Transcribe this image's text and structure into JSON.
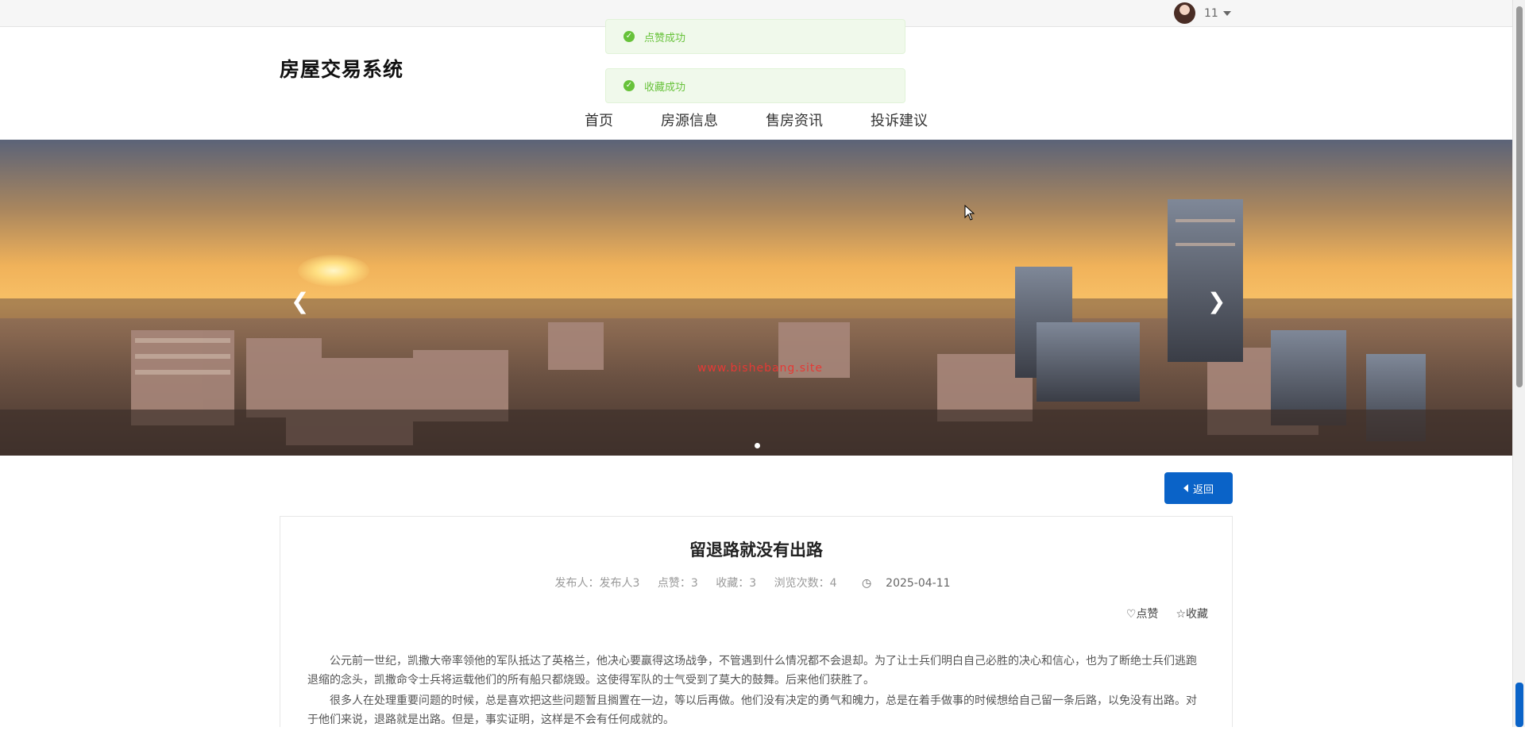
{
  "user": {
    "name": "11"
  },
  "site": {
    "title": "房屋交易系统"
  },
  "nav": [
    "首页",
    "房源信息",
    "售房资讯",
    "投诉建议"
  ],
  "toasts": [
    "点赞成功",
    "收藏成功"
  ],
  "banner": {
    "watermark": "www.bishebang.site",
    "prev_icon": "chevron-left-icon",
    "next_icon": "chevron-right-icon",
    "slide_count": 1,
    "active_slide": 1
  },
  "back_button": {
    "label": "返回"
  },
  "article": {
    "title": "留退路就没有出路",
    "publisher": "发布人：发布人3",
    "likes": "点赞：3",
    "favorites": "收藏：3",
    "views": "浏览次数：4",
    "date": "2025-04-11",
    "like_label": "点赞",
    "favorite_label": "收藏",
    "paragraphs": [
      "公元前一世纪，凯撒大帝率领他的军队抵达了英格兰，他决心要赢得这场战争，不管遇到什么情况都不会退却。为了让士兵们明白自己必胜的决心和信心，也为了断绝士兵们逃跑退缩的念头，凯撒命令士兵将运载他们的所有船只都烧毁。这使得军队的士气受到了莫大的鼓舞。后来他们获胜了。",
      "很多人在处理重要问题的时候，总是喜欢把这些问题暂且搁置在一边，等以后再做。他们没有决定的勇气和魄力，总是在着手做事的时候想给自己留一条后路，以免没有出路。对于他们来说，退路就是出路。但是，事实证明，这样是不会有任何成就的。"
    ]
  },
  "colors": {
    "primary": "#0a63c8",
    "success": "#67c23a",
    "toast_bg": "#f0f9eb"
  }
}
